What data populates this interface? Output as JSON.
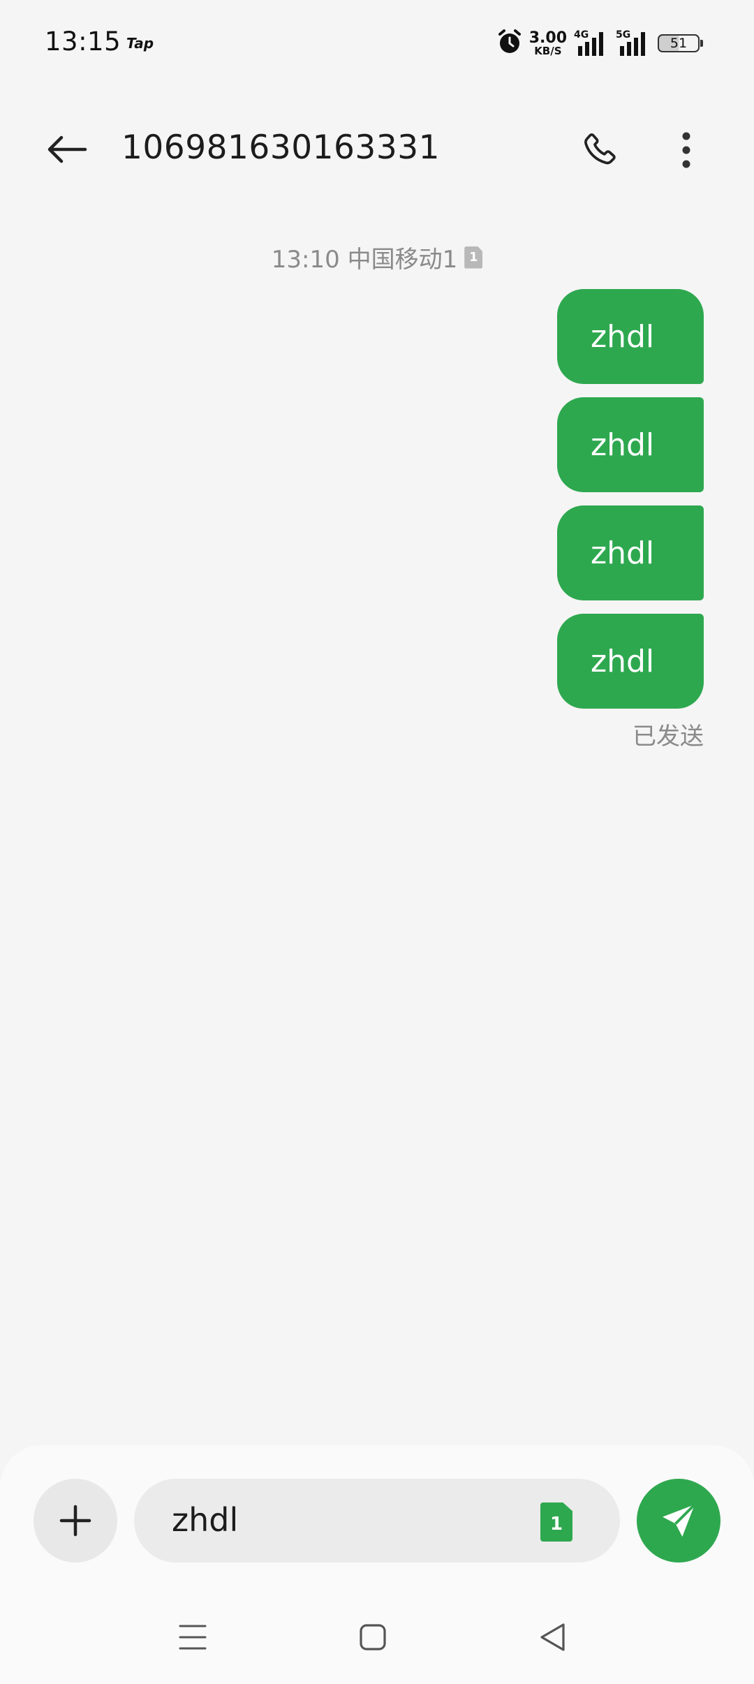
{
  "status_bar": {
    "time": "13:15",
    "app_indicator": "Tap",
    "net_speed_value": "3.00",
    "net_speed_unit": "KB/S",
    "sim1_network": "4G",
    "sim2_network": "5G",
    "battery": "51",
    "icons": [
      "alarm-icon",
      "signal-icon",
      "battery-icon"
    ]
  },
  "header": {
    "title": "106981630163331",
    "icons": [
      "back-arrow-icon",
      "phone-icon",
      "more-vertical-icon"
    ]
  },
  "conversation": {
    "timestamp": "13:10 中国移动1",
    "sim_slot": "1",
    "messages": [
      {
        "text": "zhdl"
      },
      {
        "text": "zhdl"
      },
      {
        "text": "zhdl"
      },
      {
        "text": "zhdl"
      }
    ],
    "sent_status": "已发送"
  },
  "compose": {
    "input_value": "zhdl",
    "sim_slot": "1",
    "icons": [
      "plus-icon",
      "send-icon"
    ]
  },
  "nav_bar": {
    "icons": [
      "menu-icon",
      "home-icon",
      "back-triangle-icon"
    ]
  },
  "colors": {
    "accent": "#2ea84f",
    "background": "#f5f5f5",
    "secondary_text": "#8a8a8a"
  }
}
